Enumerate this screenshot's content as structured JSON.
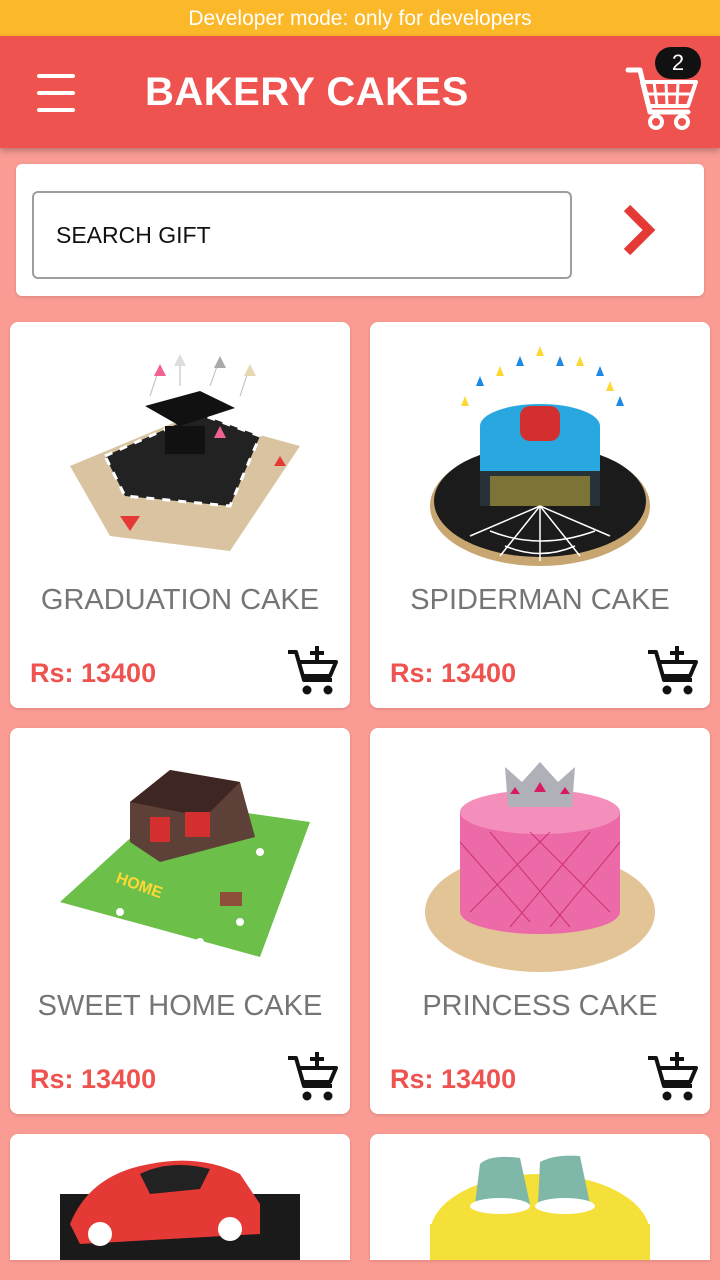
{
  "status_bar": {
    "text": "Developer mode: only for developers"
  },
  "app_bar": {
    "title": "BAKERY CAKES",
    "cart_count": "2"
  },
  "search": {
    "placeholder": "SEARCH GIFT"
  },
  "products": [
    {
      "name": "GRADUATION CAKE",
      "price": "Rs: 13400"
    },
    {
      "name": "SPIDERMAN CAKE",
      "price": "Rs: 13400"
    },
    {
      "name": "SWEET HOME CAKE",
      "price": "Rs: 13400"
    },
    {
      "name": "PRINCESS CAKE",
      "price": "Rs: 13400"
    }
  ],
  "colors": {
    "status_bar": "#fbb829",
    "app_bar": "#ef5350",
    "background": "#fb9c94",
    "price": "#ef5350"
  },
  "icons": {
    "menu": "menu-icon",
    "cart": "cart-icon",
    "search_go": "chevron-right-icon",
    "add_to_cart": "add-to-cart-icon"
  }
}
